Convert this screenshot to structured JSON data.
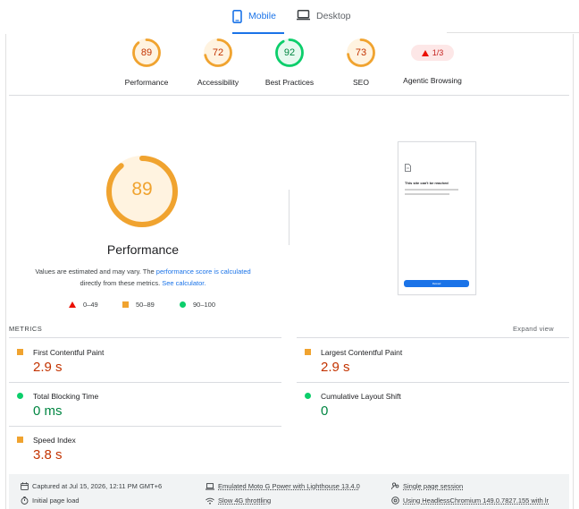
{
  "tabs": {
    "mobile": "Mobile",
    "desktop": "Desktop"
  },
  "categories": [
    {
      "score": "89",
      "label": "Performance",
      "color": "#f0a32f",
      "value": 89
    },
    {
      "score": "72",
      "label": "Accessibility",
      "color": "#f0a32f",
      "value": 72
    },
    {
      "score": "92",
      "label": "Best Practices",
      "color": "#0cce6b",
      "value": 92
    },
    {
      "score": "73",
      "label": "SEO",
      "color": "#f0a32f",
      "value": 73
    }
  ],
  "agentic": {
    "badge": "1/3",
    "label": "Agentic Browsing"
  },
  "performance": {
    "score": "89",
    "value": 89,
    "title": "Performance",
    "desc_pre": "Values are estimated and may vary. The ",
    "desc_link1": "performance score is calculated",
    "desc_mid": "directly from these metrics. ",
    "desc_link2": "See calculator.",
    "legend": {
      "fail": "0–49",
      "average": "50–89",
      "pass": "90–100"
    }
  },
  "thumbnail": {
    "heading": "This site can't be reached",
    "button": "Reload"
  },
  "metrics": {
    "heading": "METRICS",
    "expand": "Expand view",
    "items": [
      {
        "label": "First Contentful Paint",
        "value": "2.9 s",
        "status": "average"
      },
      {
        "label": "Largest Contentful Paint",
        "value": "2.9 s",
        "status": "average"
      },
      {
        "label": "Total Blocking Time",
        "value": "0 ms",
        "status": "pass"
      },
      {
        "label": "Cumulative Layout Shift",
        "value": "0",
        "status": "pass"
      },
      {
        "label": "Speed Index",
        "value": "3.8 s",
        "status": "average"
      }
    ]
  },
  "footer": {
    "captured": "Captured at Jul 15, 2026, 12:11 PM GMT+6",
    "emulated": "Emulated Moto G Power with Lighthouse 13.4.0",
    "session": "Single page session",
    "initial_load": "Initial page load",
    "throttling": "Slow 4G throttling",
    "browser": "Using HeadlessChromium 149.0.7827.155 with lr"
  },
  "colors": {
    "accent": "#1a73e8",
    "average": "#f0a32f",
    "pass": "#0cce6b",
    "fail": "#eb0f00"
  }
}
